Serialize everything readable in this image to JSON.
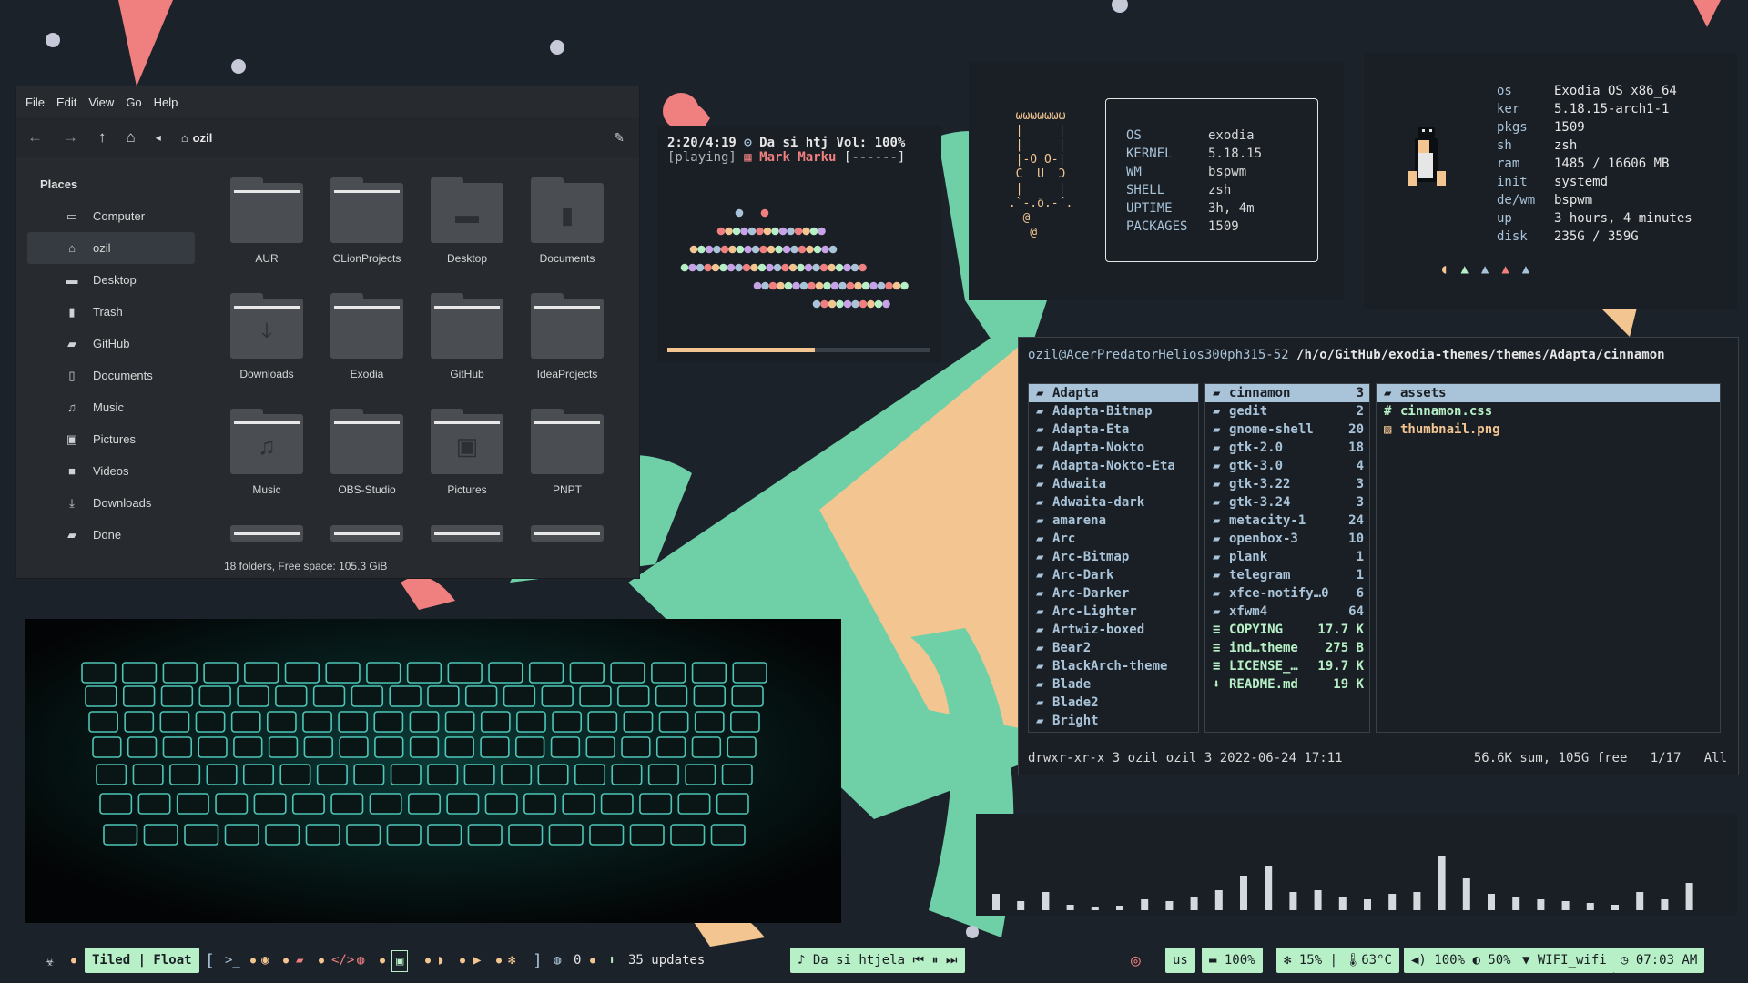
{
  "file_manager": {
    "menu": [
      "File",
      "Edit",
      "View",
      "Go",
      "Help"
    ],
    "location": "ozil",
    "places_header": "Places",
    "places": [
      {
        "label": "Computer",
        "icon": "computer-icon"
      },
      {
        "label": "ozil",
        "icon": "home-icon"
      },
      {
        "label": "Desktop",
        "icon": "desktop-icon"
      },
      {
        "label": "Trash",
        "icon": "trash-icon"
      },
      {
        "label": "GitHub",
        "icon": "folder-icon"
      },
      {
        "label": "Documents",
        "icon": "document-icon"
      },
      {
        "label": "Music",
        "icon": "music-icon"
      },
      {
        "label": "Pictures",
        "icon": "pictures-icon"
      },
      {
        "label": "Videos",
        "icon": "video-icon"
      },
      {
        "label": "Downloads",
        "icon": "download-icon"
      },
      {
        "label": "Done",
        "icon": "folder-icon"
      }
    ],
    "folders": [
      {
        "name": "AUR",
        "icon": ""
      },
      {
        "name": "CLionProjects",
        "icon": ""
      },
      {
        "name": "Desktop",
        "icon": "desktop"
      },
      {
        "name": "Documents",
        "icon": "document"
      },
      {
        "name": "Downloads",
        "icon": "download"
      },
      {
        "name": "Exodia",
        "icon": ""
      },
      {
        "name": "GitHub",
        "icon": ""
      },
      {
        "name": "IdeaProjects",
        "icon": ""
      },
      {
        "name": "Music",
        "icon": "music"
      },
      {
        "name": "OBS-Studio",
        "icon": ""
      },
      {
        "name": "Pictures",
        "icon": "pictures"
      },
      {
        "name": "PNPT",
        "icon": ""
      }
    ],
    "status": "18 folders, Free space: 105.3 GiB"
  },
  "music": {
    "time": "2:20/4:19",
    "title": "Da si htj",
    "volume": "Vol: 100%",
    "state": "[playing]",
    "artist": "Mark Marku",
    "flags": "[------]",
    "progress": 0.56
  },
  "fetch_small": {
    "ascii": "  ωωωωωωω\n  |     |\n  |     |\n  |-O O-|\n  C  U  Ɔ\n  |     |\n .`-.ö.-´.\n   @\n    @",
    "rows": [
      {
        "key": "OS",
        "value": "exodia"
      },
      {
        "key": "KERNEL",
        "value": "5.18.15"
      },
      {
        "key": "WM",
        "value": "bspwm"
      },
      {
        "key": "SHELL",
        "value": "zsh"
      },
      {
        "key": "UPTIME",
        "value": "3h, 4m"
      },
      {
        "key": "PACKAGES",
        "value": "1509"
      }
    ]
  },
  "fetch_large": {
    "rows": [
      {
        "key": "os",
        "value": "Exodia OS x86_64"
      },
      {
        "key": "ker",
        "value": "5.18.15-arch1-1"
      },
      {
        "key": "pkgs",
        "value": "1509"
      },
      {
        "key": "sh",
        "value": "zsh"
      },
      {
        "key": "ram",
        "value": "1485 / 16606 MB"
      },
      {
        "key": "init",
        "value": "systemd"
      },
      {
        "key": "de/wm",
        "value": "bspwm"
      },
      {
        "key": "up",
        "value": "3 hours, 4 minutes"
      },
      {
        "key": "disk",
        "value": "235G / 359G"
      }
    ],
    "ghost_colors": [
      "#f2c591",
      "#b7f0c6",
      "#a9c3d9",
      "#f08080",
      "#a9c3d9"
    ]
  },
  "terminal": {
    "host": "ozil@AcerPredatorHelios300ph315-52",
    "path": "/h/o/GitHub/exodia-themes/themes/Adapta/cinnamon",
    "col1": [
      "Adapta",
      "Adapta-Bitmap",
      "Adapta-Eta",
      "Adapta-Nokto",
      "Adapta-Nokto-Eta",
      "Adwaita",
      "Adwaita-dark",
      "amarena",
      "Arc",
      "Arc-Bitmap",
      "Arc-Dark",
      "Arc-Darker",
      "Arc-Lighter",
      "Artwiz-boxed",
      "Bear2",
      "BlackArch-theme",
      "Blade",
      "Blade2",
      "Bright"
    ],
    "col2": [
      {
        "name": "cinnamon",
        "count": "3",
        "type": "dir"
      },
      {
        "name": "gedit",
        "count": "2",
        "type": "dir"
      },
      {
        "name": "gnome-shell",
        "count": "20",
        "type": "dir"
      },
      {
        "name": "gtk-2.0",
        "count": "18",
        "type": "dir"
      },
      {
        "name": "gtk-3.0",
        "count": "4",
        "type": "dir"
      },
      {
        "name": "gtk-3.22",
        "count": "3",
        "type": "dir"
      },
      {
        "name": "gtk-3.24",
        "count": "3",
        "type": "dir"
      },
      {
        "name": "metacity-1",
        "count": "24",
        "type": "dir"
      },
      {
        "name": "openbox-3",
        "count": "10",
        "type": "dir"
      },
      {
        "name": "plank",
        "count": "1",
        "type": "dir"
      },
      {
        "name": "telegram",
        "count": "1",
        "type": "dir"
      },
      {
        "name": "xfce-notify…0",
        "count": "6",
        "type": "dir"
      },
      {
        "name": "xfwm4",
        "count": "64",
        "type": "dir"
      },
      {
        "name": "COPYING",
        "count": "17.7 K",
        "type": "file"
      },
      {
        "name": "ind…theme",
        "count": "275 B",
        "type": "file"
      },
      {
        "name": "LICENSE_…",
        "count": "19.7 K",
        "type": "file"
      },
      {
        "name": "README.md",
        "count": "19 K",
        "type": "file"
      }
    ],
    "col3": [
      {
        "name": "assets",
        "type": "dir"
      },
      {
        "name": "cinnamon.css",
        "type": "css"
      },
      {
        "name": "thumbnail.png",
        "type": "img"
      }
    ],
    "status_left": "drwxr-xr-x 3 ozil ozil 3 2022-06-24 17:11",
    "status_right": "56.6K sum, 105G free   1/17   All"
  },
  "visualizer": {
    "levels": [
      0.18,
      0.1,
      0.2,
      0.06,
      0.03,
      0.05,
      0.12,
      0.1,
      0.14,
      0.22,
      0.38,
      0.48,
      0.2,
      0.22,
      0.15,
      0.12,
      0.18,
      0.2,
      0.6,
      0.35,
      0.18,
      0.14,
      0.12,
      0.1,
      0.08,
      0.06,
      0.2,
      0.12,
      0.3
    ]
  },
  "taskbar": {
    "layout_mode": "Tiled | Float",
    "github_count": "0",
    "updates": "35 updates",
    "now_playing": "Da si htjela",
    "keyboard": "us",
    "battery": "100%",
    "cpu": "15%",
    "temp": "63°C",
    "volume": "100%",
    "brightness": "50%",
    "wifi": "WIFI_wifi",
    "clock": "07:03 AM"
  },
  "colors": {
    "accent_green": "#b7f0c6",
    "accent_blue": "#a9c3d9",
    "accent_orange": "#f2c591",
    "accent_red": "#f08080",
    "panel_bg": "#1a1f25"
  }
}
